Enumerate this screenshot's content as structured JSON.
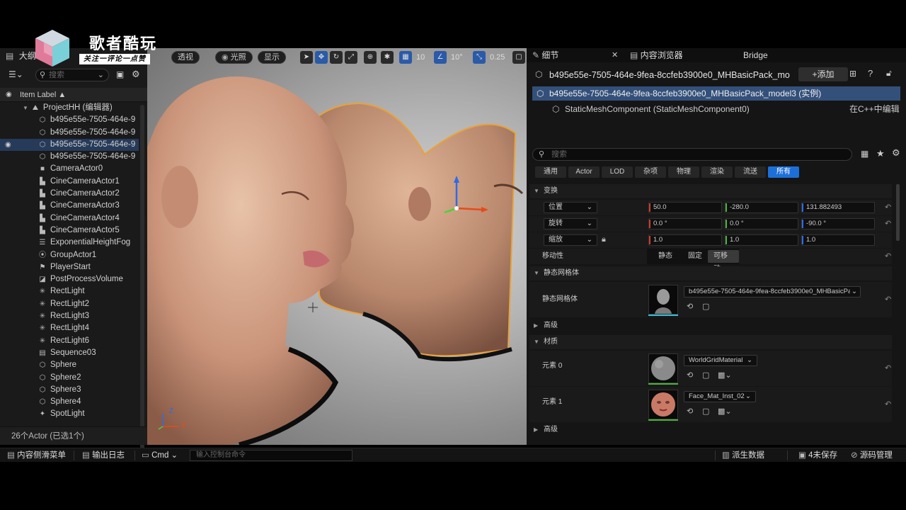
{
  "watermark": {
    "title": "歌者酷玩",
    "tagline": "关注一评论一点赞"
  },
  "outliner": {
    "tab_label": "大纲",
    "search_placeholder": "搜索",
    "column_header": "Item Label ▲",
    "status": "26个Actor (已选1个)",
    "items": [
      {
        "label": "ProjectHH (编辑器)",
        "icon": "level-icon",
        "indent": 1
      },
      {
        "label": "b495e55e-7505-464e-9",
        "icon": "static-mesh-icon",
        "indent": 2
      },
      {
        "label": "b495e55e-7505-464e-9",
        "icon": "static-mesh-icon",
        "indent": 2
      },
      {
        "label": "b495e55e-7505-464e-9",
        "icon": "static-mesh-icon",
        "indent": 2,
        "selected": true
      },
      {
        "label": "b495e55e-7505-464e-9",
        "icon": "static-mesh-icon",
        "indent": 2
      },
      {
        "label": "CameraActor0",
        "icon": "camera-icon",
        "indent": 2
      },
      {
        "label": "CineCameraActor1",
        "icon": "cine-camera-icon",
        "indent": 2
      },
      {
        "label": "CineCameraActor2",
        "icon": "cine-camera-icon",
        "indent": 2
      },
      {
        "label": "CineCameraActor3",
        "icon": "cine-camera-icon",
        "indent": 2
      },
      {
        "label": "CineCameraActor4",
        "icon": "cine-camera-icon",
        "indent": 2
      },
      {
        "label": "CineCameraActor5",
        "icon": "cine-camera-icon",
        "indent": 2
      },
      {
        "label": "ExponentialHeightFog",
        "icon": "fog-icon",
        "indent": 2
      },
      {
        "label": "GroupActor1",
        "icon": "group-icon",
        "indent": 2
      },
      {
        "label": "PlayerStart",
        "icon": "player-start-icon",
        "indent": 2
      },
      {
        "label": "PostProcessVolume",
        "icon": "volume-icon",
        "indent": 2
      },
      {
        "label": "RectLight",
        "icon": "rect-light-icon",
        "indent": 2
      },
      {
        "label": "RectLight2",
        "icon": "rect-light-icon",
        "indent": 2
      },
      {
        "label": "RectLight3",
        "icon": "rect-light-icon",
        "indent": 2
      },
      {
        "label": "RectLight4",
        "icon": "rect-light-icon",
        "indent": 2
      },
      {
        "label": "RectLight6",
        "icon": "rect-light-icon",
        "indent": 2
      },
      {
        "label": "Sequence03",
        "icon": "sequence-icon",
        "indent": 2
      },
      {
        "label": "Sphere",
        "icon": "static-mesh-icon",
        "indent": 2
      },
      {
        "label": "Sphere2",
        "icon": "static-mesh-icon",
        "indent": 2
      },
      {
        "label": "Sphere3",
        "icon": "static-mesh-icon",
        "indent": 2
      },
      {
        "label": "Sphere4",
        "icon": "static-mesh-icon",
        "indent": 2
      },
      {
        "label": "SpotLight",
        "icon": "spot-light-icon",
        "indent": 2
      }
    ]
  },
  "viewport": {
    "perspective_label": "透视",
    "lit_label": "光照",
    "show_label": "显示",
    "grid_snap": "10",
    "rotation_snap": "10°",
    "scale_snap": "0.25",
    "axis_z": "Z",
    "axis_x": "X"
  },
  "details": {
    "tabs": {
      "details": "细节",
      "content_browser": "内容浏览器",
      "bridge": "Bridge"
    },
    "actor_title": "b495e55e-7505-464e-9fea-8ccfeb3900e0_MHBasicPack_mo",
    "add_label": "+添加",
    "selected_component": "b495e55e-7505-464e-9fea-8ccfeb3900e0_MHBasicPack_model3 (实例)",
    "sub_component": "StaticMeshComponent (StaticMeshComponent0)",
    "edit_in_cpp": "在C++中编辑",
    "search_placeholder": "搜索",
    "filters": [
      "通用",
      "Actor",
      "LOD",
      "杂项",
      "物理",
      "渲染",
      "流送",
      "所有"
    ],
    "active_filter": "所有",
    "transform": {
      "section": "变换",
      "location_label": "位置",
      "location": [
        "50.0",
        "-280.0",
        "131.882493"
      ],
      "rotation_label": "旋转",
      "rotation": [
        "0.0 °",
        "0.0 °",
        "-90.0 °"
      ],
      "scale_label": "缩放",
      "scale": [
        "1.0",
        "1.0",
        "1.0"
      ],
      "mobility_label": "移动性",
      "mobility_options": [
        "静态",
        "固定",
        "可移动"
      ],
      "mobility_selected": "可移动"
    },
    "static_mesh": {
      "section": "静态网格体",
      "label": "静态网格体",
      "value": "b495e55e-7505-464e-9fea-8ccfeb3900e0_MHBasicPa"
    },
    "advanced_label": "高级",
    "materials": {
      "section": "材质",
      "element0_label": "元素 0",
      "element0_value": "WorldGridMaterial",
      "element1_label": "元素 1",
      "element1_value": "Face_Mat_Inst_02"
    },
    "advanced_label2": "高级"
  },
  "statusbar": {
    "content_drawer": "内容侧滑菜单",
    "output_log": "输出日志",
    "cmd_label": "Cmd",
    "cmd_placeholder": "输入控制台命令",
    "derived_data": "派生数据",
    "unsaved": "4未保存",
    "source_control": "源码管理"
  },
  "colors": {
    "accent": "#1d6fd8",
    "selection": "#263a5a",
    "gizmo_outline": "#e8a23a"
  }
}
